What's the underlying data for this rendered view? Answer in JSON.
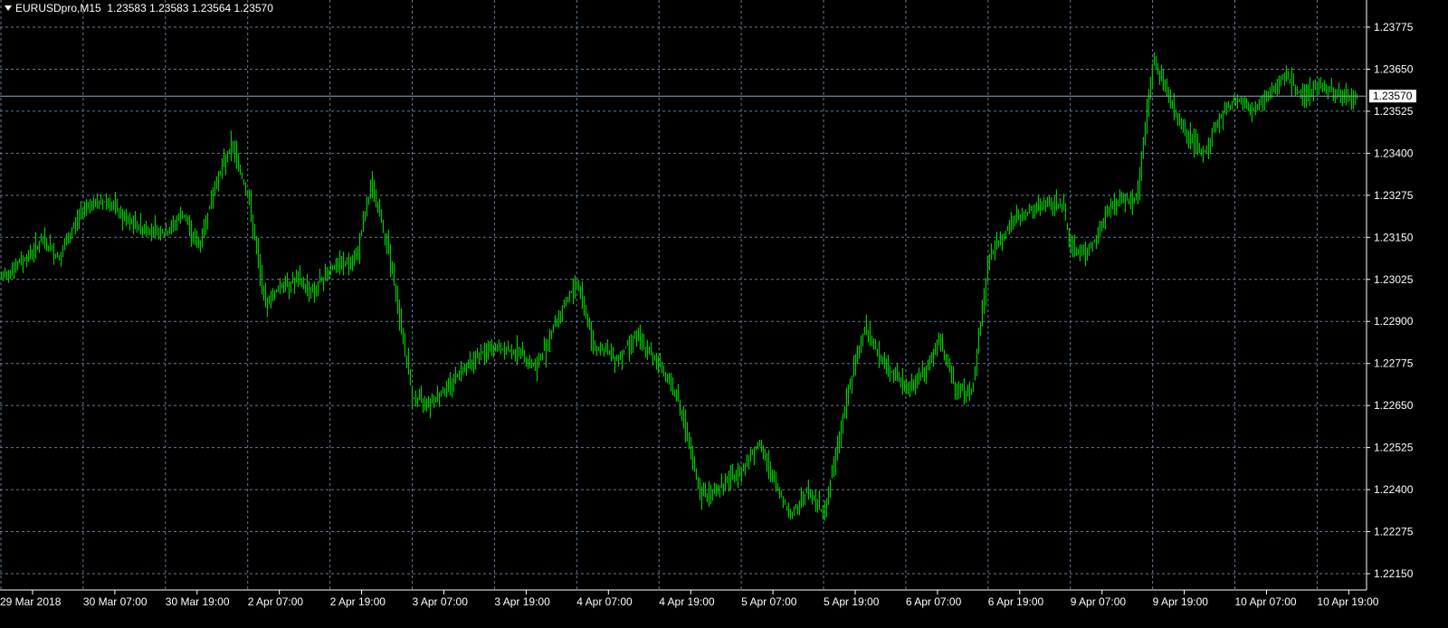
{
  "header": {
    "symbol_label": "EURUSDpro,M15",
    "ohlc": "1.23583 1.23583 1.23564 1.23570"
  },
  "colors": {
    "background": "#000000",
    "grid": "#5f7a99",
    "bars": "#00c800",
    "axis_text": "#ffffff",
    "bid_line": "#8da3bd",
    "price_tag_bg": "#ffffff",
    "price_tag_text": "#000000"
  },
  "chart_data": {
    "type": "line",
    "title": "EURUSDpro,M15",
    "xlabel": "",
    "ylabel": "",
    "grid": true,
    "ylim": [
      1.2209,
      1.2386
    ],
    "y_ticks": [
      "1.23775",
      "1.23650",
      "1.23525",
      "1.23400",
      "1.23275",
      "1.23150",
      "1.23025",
      "1.22900",
      "1.22775",
      "1.22650",
      "1.22525",
      "1.22400",
      "1.22275",
      "1.22150"
    ],
    "x_ticks": [
      "29 Mar 2018",
      "30 Mar 07:00",
      "30 Mar 19:00",
      "2 Apr 07:00",
      "2 Apr 19:00",
      "3 Apr 07:00",
      "3 Apr 19:00",
      "4 Apr 07:00",
      "4 Apr 19:00",
      "5 Apr 07:00",
      "5 Apr 19:00",
      "6 Apr 07:00",
      "6 Apr 19:00",
      "9 Apr 07:00",
      "9 Apr 19:00",
      "10 Apr 07:00",
      "10 Apr 19:00"
    ],
    "current_price": "1.23570",
    "series": [
      {
        "x_index": [
          0,
          0.3,
          0.5,
          0.7,
          1.0,
          1.3,
          1.5,
          1.7,
          2.0,
          2.2,
          2.4,
          2.6,
          2.8,
          3.0,
          3.2,
          3.4,
          3.6,
          3.8,
          4.0,
          4.3,
          4.5,
          4.7,
          5.0,
          5.2,
          5.4,
          5.6,
          5.8,
          6.0,
          6.3,
          6.5,
          6.7,
          7.0,
          7.2,
          7.5,
          7.7,
          8.0,
          8.2,
          8.5,
          8.7,
          9.0,
          9.2,
          9.4,
          9.6,
          9.8,
          10.0,
          10.3,
          10.5,
          10.7,
          11.0,
          11.2,
          11.4,
          11.6,
          11.8,
          12.0,
          12.3,
          12.6,
          12.9,
          13.0,
          13.2,
          13.5,
          13.8,
          14.0,
          14.3,
          14.6,
          14.8,
          15.0,
          15.2,
          15.4,
          15.6,
          15.8,
          16.0,
          16.3,
          16.5
        ],
        "values": [
          1.2303,
          1.2309,
          1.2314,
          1.2309,
          1.2324,
          1.2326,
          1.232,
          1.2318,
          1.2316,
          1.2322,
          1.2312,
          1.2331,
          1.2343,
          1.2327,
          1.2295,
          1.2301,
          1.2302,
          1.2299,
          1.2306,
          1.2308,
          1.2331,
          1.2312,
          1.2267,
          1.2266,
          1.227,
          1.2276,
          1.228,
          1.2282,
          1.2281,
          1.2276,
          1.2288,
          1.2302,
          1.2283,
          1.2279,
          1.2286,
          1.2277,
          1.2269,
          1.2238,
          1.224,
          1.2246,
          1.2254,
          1.2242,
          1.2232,
          1.224,
          1.2233,
          1.227,
          1.2289,
          1.2278,
          1.227,
          1.2274,
          1.2284,
          1.227,
          1.2269,
          1.2309,
          1.232,
          1.2324,
          1.2325,
          1.2312,
          1.231,
          1.2325,
          1.2327,
          1.2368,
          1.235,
          1.2339,
          1.235,
          1.2356,
          1.2353,
          1.2357,
          1.2364,
          1.2357,
          1.236,
          1.2357,
          1.2357
        ]
      }
    ]
  }
}
